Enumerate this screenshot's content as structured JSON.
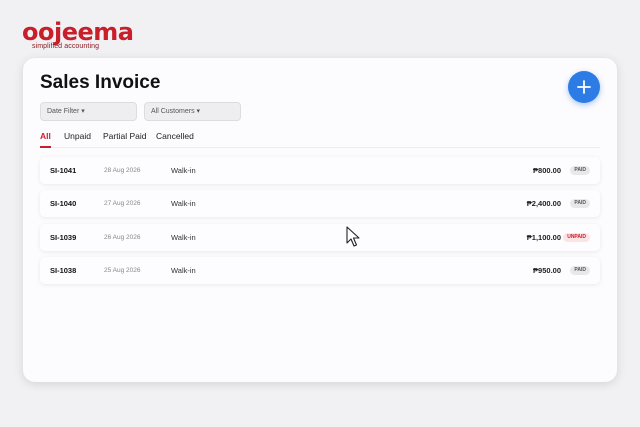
{
  "brand": {
    "name": "oojeema",
    "tagline": "simplified accounting",
    "color": "#c8202a"
  },
  "page": {
    "title": "Sales Invoice",
    "add_button_icon": "plus-icon",
    "accent": "#2d7be5"
  },
  "filters": {
    "date": "Date Filter ▾",
    "customer": "All Customers ▾"
  },
  "tabs": [
    {
      "label": "All",
      "active": true
    },
    {
      "label": "Unpaid",
      "active": false
    },
    {
      "label": "Partial Paid",
      "active": false
    },
    {
      "label": "Cancelled",
      "active": false
    }
  ],
  "invoices": [
    {
      "number": "SI-1041",
      "date": "28 Aug 2026",
      "customer": "Walk-in",
      "amount": "₱800.00",
      "status": "PAID"
    },
    {
      "number": "SI-1040",
      "date": "27 Aug 2026",
      "customer": "Walk-in",
      "amount": "₱2,400.00",
      "status": "PAID"
    },
    {
      "number": "SI-1039",
      "date": "26 Aug 2026",
      "customer": "Walk-in",
      "amount": "₱1,100.00",
      "status": "UNPAID"
    },
    {
      "number": "SI-1038",
      "date": "25 Aug 2026",
      "customer": "Walk-in",
      "amount": "₱950.00",
      "status": "PAID"
    }
  ]
}
